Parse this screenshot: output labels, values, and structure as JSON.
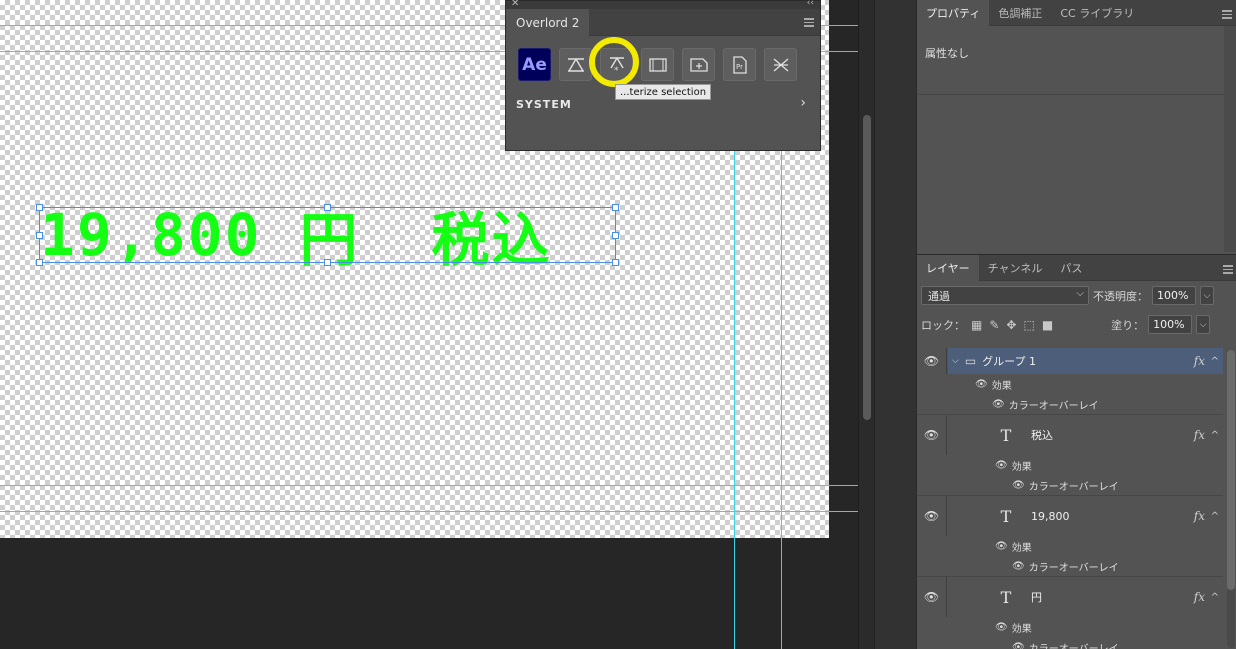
{
  "canvas": {
    "text_chars": [
      "1",
      "9",
      ",",
      "8",
      "0",
      "0",
      " ",
      "円",
      " ",
      "税",
      "込"
    ],
    "text_color": "#14ff14"
  },
  "overlord": {
    "title": "Overlord 2",
    "ae_label": "Ae",
    "tooltip": "...terize selection",
    "section": "SYSTEM",
    "tool_icons": [
      "ae-icon",
      "align-icon",
      "rasterize-icon",
      "film-icon",
      "add-frame-icon",
      "script-icon",
      "crossed-icon"
    ],
    "highlight_color": "#f2ea00"
  },
  "properties_panel": {
    "tabs": [
      "プロパティ",
      "色調補正",
      "CC ライブラリ"
    ],
    "empty_text": "属性なし"
  },
  "layers_panel": {
    "tabs": [
      "レイヤー",
      "チャンネル",
      "パス"
    ],
    "blend_mode": "通過",
    "opacity_label": "不透明度：",
    "opacity_value": "100%",
    "lock_label": "ロック：",
    "fill_label": "塗り：",
    "fill_value": "100%",
    "fx_label": "fx",
    "layers": [
      {
        "type": "group",
        "name": "グループ 1",
        "effects_label": "効果",
        "effect": "カラーオーバーレイ"
      },
      {
        "type": "text",
        "name": "税込",
        "effects_label": "効果",
        "effect": "カラーオーバーレイ"
      },
      {
        "type": "text",
        "name": "19,800",
        "effects_label": "効果",
        "effect": "カラーオーバーレイ"
      },
      {
        "type": "text",
        "name": "円",
        "effects_label": "効果",
        "effect": "カラーオーバーレイ"
      }
    ]
  }
}
